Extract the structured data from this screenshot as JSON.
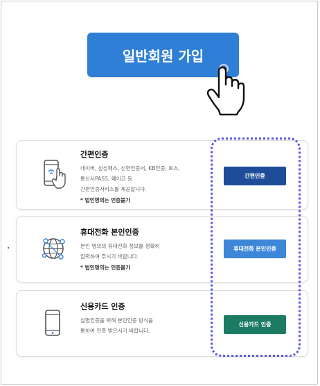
{
  "signup": {
    "button_label": "일반회원 가입"
  },
  "cards": [
    {
      "title": "간편인증",
      "description": "네이버, 삼성패스, 신한인증서, KB인증, 토스,\n통신사PASS, 페이코 등\n간편인증서비스를 제공합니다.",
      "note": "* 법인명의는 인증불가",
      "button_label": "간편인증",
      "button_color": "#1f4c99",
      "icon": "phone-touch-icon"
    },
    {
      "title": "휴대전화 본인인증",
      "description": "본인 명의의 휴대전화 정보를 정확히\n입력하여 주시기 바랍니다.",
      "note": "* 법인명의는 인증불가",
      "button_label": "휴대전화 본인인증",
      "button_color": "#3d86d8",
      "icon": "globe-network-icon"
    },
    {
      "title": "신용카드 인증",
      "description": "실명인증을 위해 본인인증 방식을\n통하여 인증 받으시기 바랍니다.",
      "note": "",
      "button_label": "신용카드 인증",
      "button_color": "#1c7b63",
      "icon": "mobile-phone-icon"
    }
  ],
  "highlight_color": "#5556e5"
}
